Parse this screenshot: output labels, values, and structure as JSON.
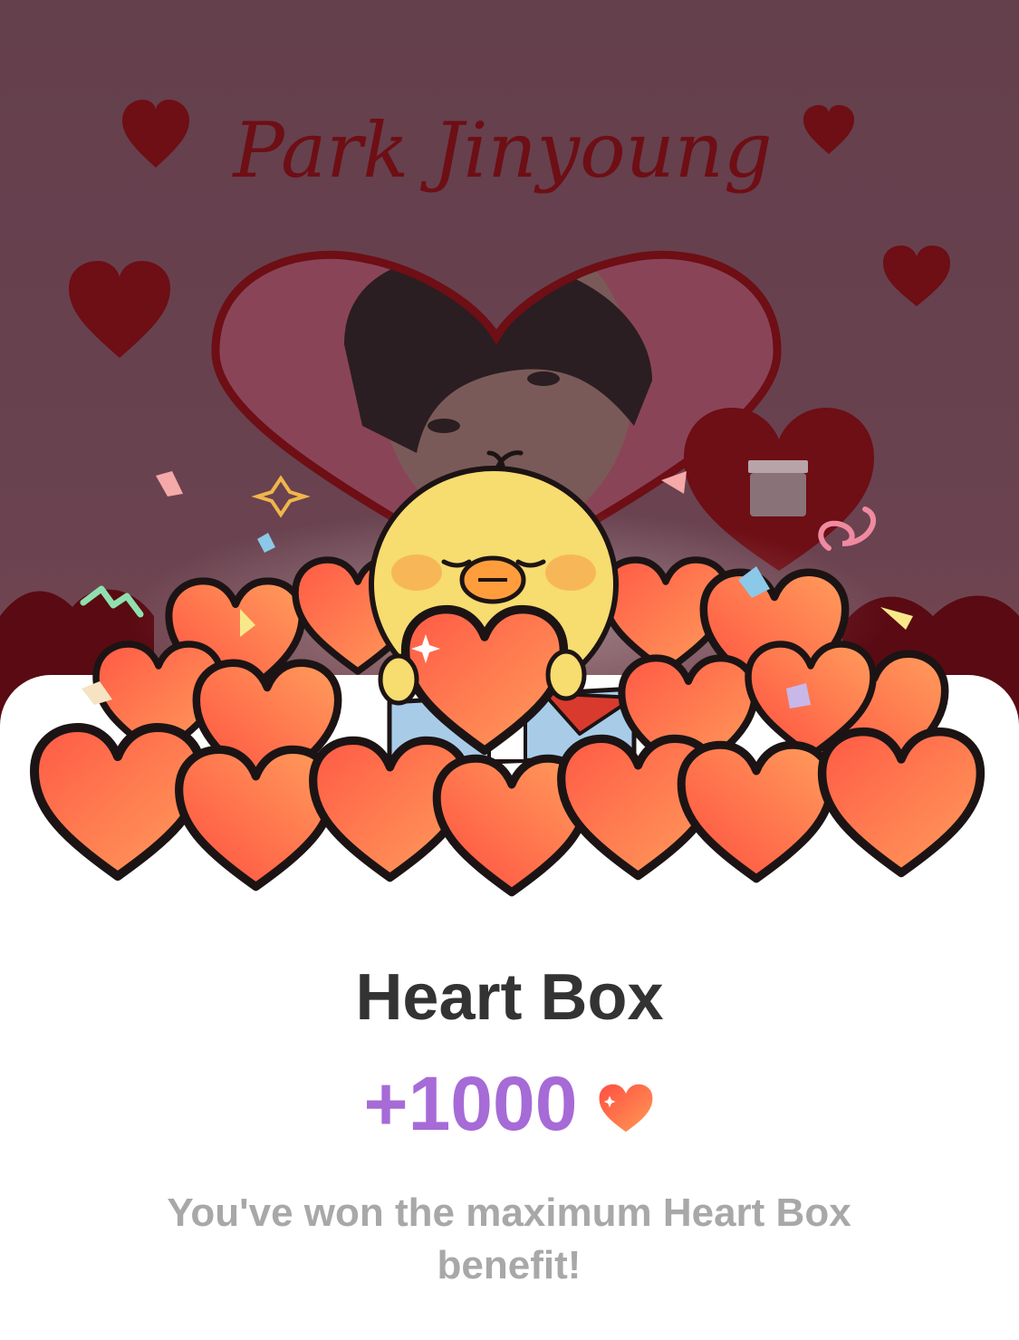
{
  "banner": {
    "artist_name": "Park Jinyoung"
  },
  "popup": {
    "title": "Heart Box",
    "reward_amount": "+1000",
    "reward_icon": "heart-icon",
    "message": "You've won the maximum Heart Box benefit!"
  },
  "colors": {
    "backdrop": "#643f4c",
    "banner_heart": "#6e0e15",
    "title_text": "#333333",
    "reward_text": "#a66bd6",
    "message_text": "#a8a8a8",
    "heart_fill_light": "#ff9a57",
    "heart_fill_dark": "#ff4f40",
    "character_body": "#f7dc6f"
  }
}
